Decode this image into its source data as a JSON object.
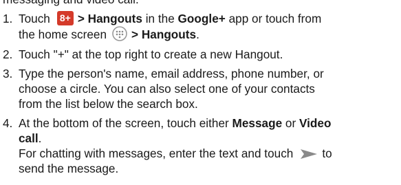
{
  "intro_text": "messaging and video call.",
  "steps": [
    {
      "number": "1.",
      "pre": "Touch",
      "gplus_icon_text": "8+",
      "bold1": "> Hangouts",
      "mid1": " in the ",
      "bold2": "Google+",
      "mid2": " app or touch from",
      "line2_pre": "the home screen",
      "bold3": "> Hangouts",
      "end": "."
    },
    {
      "number": "2.",
      "text": "Touch \"+\" at the top right to create a new Hangout."
    },
    {
      "number": "3.",
      "lines": [
        "Type the person's name, email address, phone number, or",
        "choose a circle. You can also select one of your contacts",
        "from the list below the search box."
      ]
    },
    {
      "number": "4.",
      "line1_pre": "At the bottom of the screen, touch either ",
      "bold_message": "Message",
      "or_text": " or ",
      "bold_video": "Video",
      "line2_bold": "call",
      "line2_end": ".",
      "note_pre": "For chatting with messages, enter the text and touch",
      "note_post": "to",
      "note_line2": "send the message."
    }
  ],
  "icons": {
    "gplus": "google-plus-icon",
    "apps": "apps-launcher-icon",
    "send": "send-arrow-icon"
  },
  "colors": {
    "gplus_red": "#d43a2a",
    "icon_gray": "#8a8a8a"
  }
}
